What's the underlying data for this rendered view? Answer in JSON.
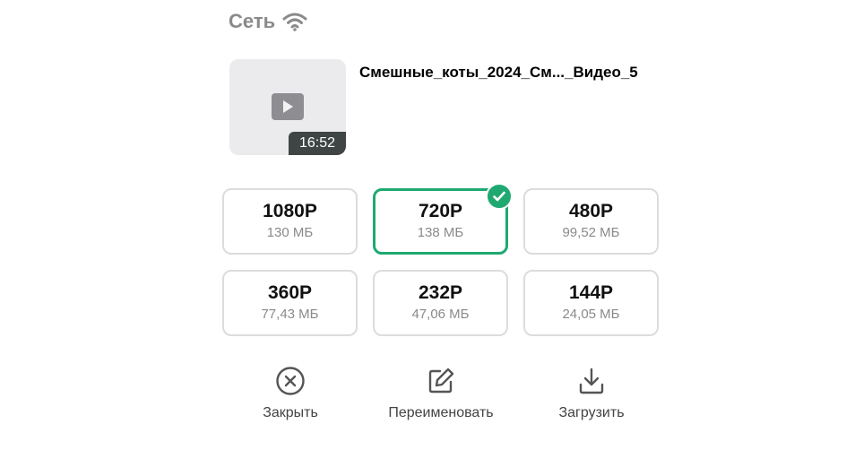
{
  "network": {
    "label": "Сеть",
    "icon": "wifi-icon"
  },
  "video": {
    "title": "Смешные_коты_2024_См..._Видео_5",
    "duration": "16:52",
    "thumbnail_icon": "play-icon"
  },
  "qualities": [
    {
      "res": "1080P",
      "size": "130 МБ",
      "selected": false
    },
    {
      "res": "720P",
      "size": "138 МБ",
      "selected": true
    },
    {
      "res": "480P",
      "size": "99,52 МБ",
      "selected": false
    },
    {
      "res": "360P",
      "size": "77,43 МБ",
      "selected": false
    },
    {
      "res": "232P",
      "size": "47,06 МБ",
      "selected": false
    },
    {
      "res": "144P",
      "size": "24,05 МБ",
      "selected": false
    }
  ],
  "actions": {
    "close": {
      "label": "Закрыть",
      "icon": "close-circle-icon"
    },
    "rename": {
      "label": "Переименовать",
      "icon": "edit-icon"
    },
    "download": {
      "label": "Загрузить",
      "icon": "download-icon"
    }
  },
  "colors": {
    "accent": "#1fa971",
    "muted": "#8a8a8a"
  }
}
